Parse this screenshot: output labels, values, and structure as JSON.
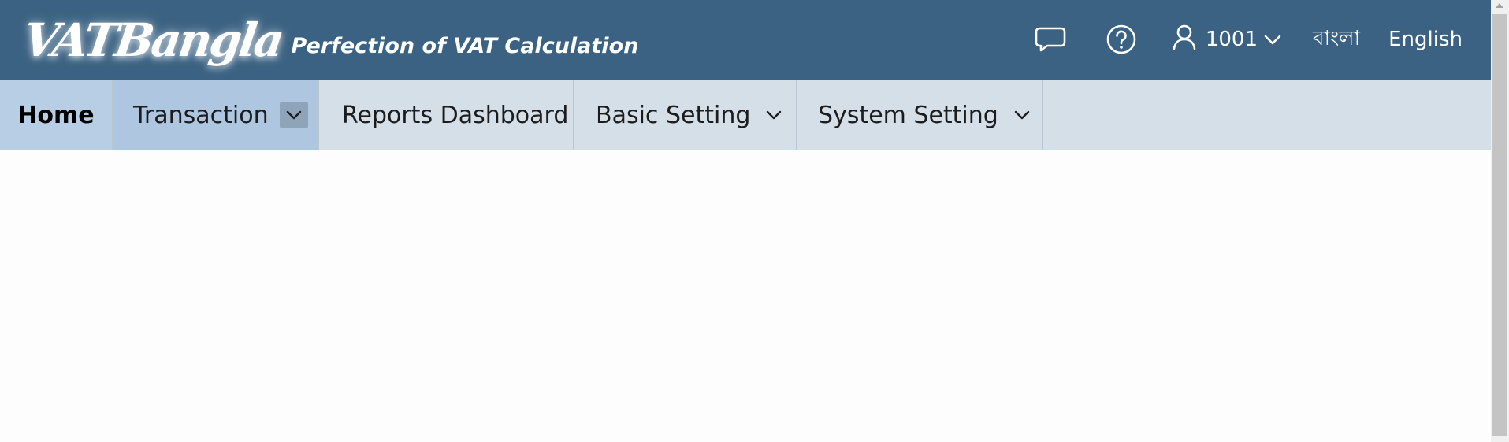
{
  "header": {
    "logo_text": "VATBangla",
    "tagline": "Perfection of VAT Calculation",
    "user_id": "1001",
    "lang_bangla": "বাংলা",
    "lang_english": "English",
    "icons": [
      "chat-icon",
      "help-icon",
      "user-icon",
      "chevron-down-icon"
    ],
    "background_color": "#3b6282"
  },
  "nav": {
    "items": [
      {
        "label": "Home",
        "has_dropdown": false
      },
      {
        "label": "Transaction",
        "has_dropdown": true
      },
      {
        "label": "Reports Dashboard",
        "has_dropdown": false
      },
      {
        "label": "Basic Setting",
        "has_dropdown": true
      },
      {
        "label": "System Setting",
        "has_dropdown": true
      }
    ],
    "background_color": "#d5dfe8",
    "active_color": "#aec6e0"
  }
}
